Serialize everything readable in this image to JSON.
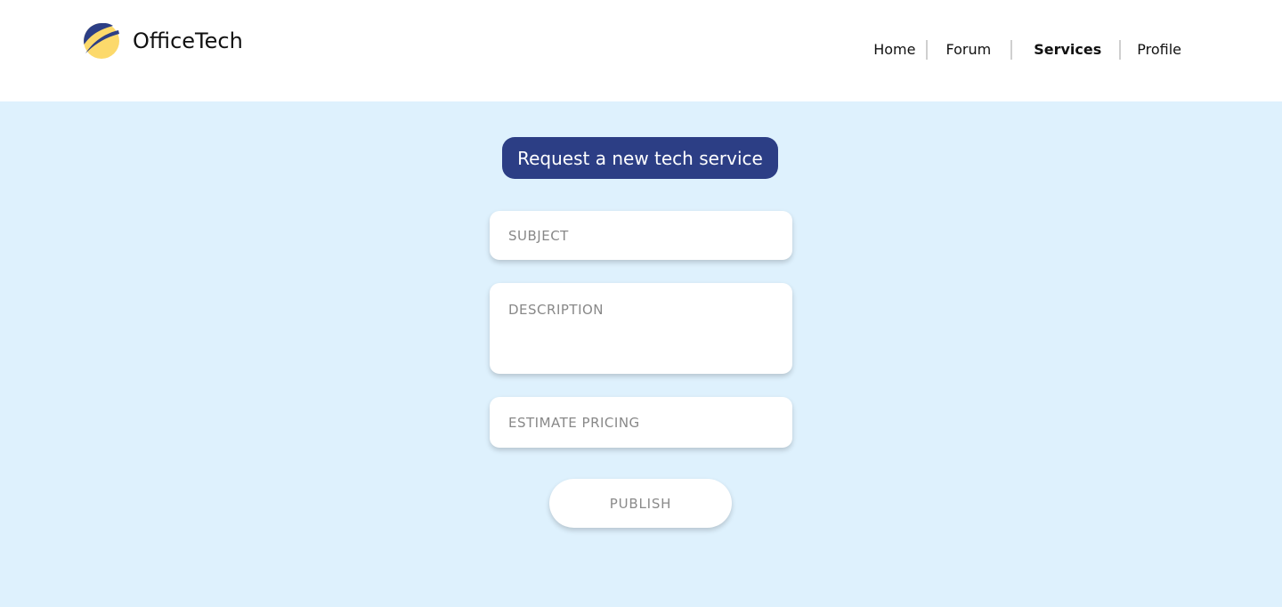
{
  "brand": {
    "name": "OfficeTech",
    "logo_icon": "officetech-logo-icon",
    "logo_colors": {
      "circle": "#fcd96b",
      "swoosh": "#2c3e85"
    }
  },
  "nav": {
    "items": [
      {
        "label": "Home",
        "active": false
      },
      {
        "label": "Forum",
        "active": false
      },
      {
        "label": "Services",
        "active": true
      },
      {
        "label": "Profile",
        "active": false
      }
    ]
  },
  "page": {
    "title": "Request a new tech service",
    "background_color": "#def1fd",
    "accent_color": "#2c3e85"
  },
  "form": {
    "subject": {
      "placeholder": "SUBJECT",
      "value": ""
    },
    "description": {
      "placeholder": "DESCRIPTION",
      "value": ""
    },
    "estimate_pricing": {
      "placeholder": "ESTIMATE PRICING",
      "value": ""
    },
    "publish_label": "PUBLISH"
  }
}
